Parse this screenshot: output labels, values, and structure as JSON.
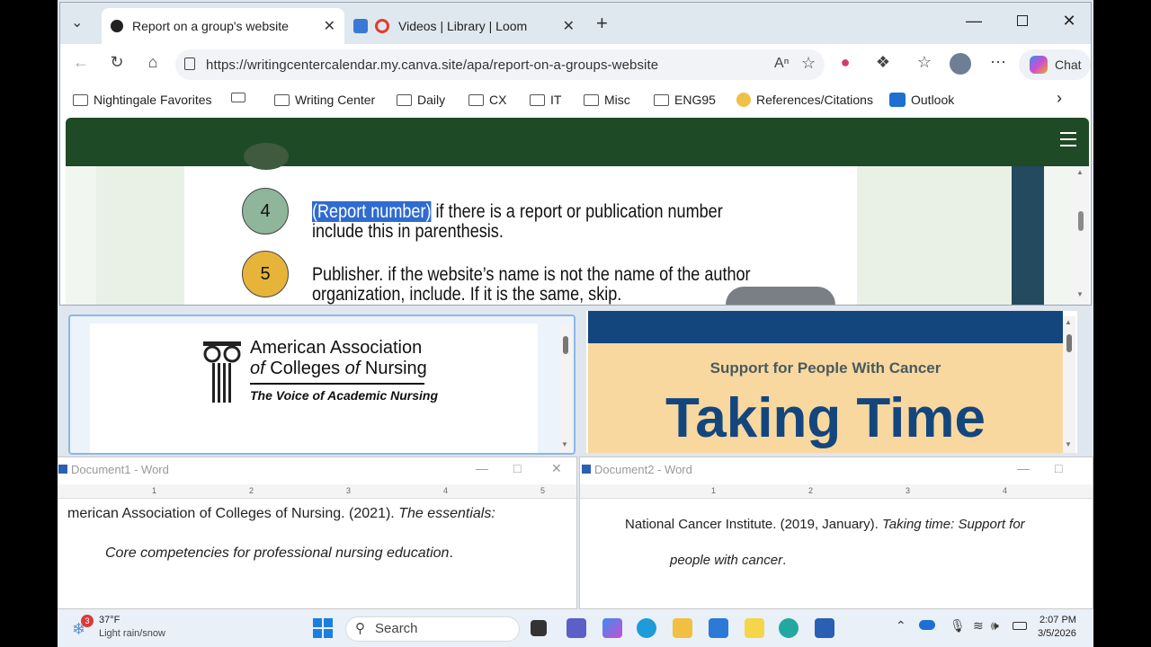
{
  "browser": {
    "tabs": [
      {
        "label": "Report on a group's website",
        "icon": "canva-icon"
      },
      {
        "label": "Videos | Library | Loom",
        "icon": "loom-icon"
      }
    ],
    "url": "https://writingcentercalendar.my.canva.site/apa/report-on-a-groups-website",
    "chat_label": "Chat",
    "bookmarks": [
      "Nightingale Favorites",
      "Writing Center",
      "Daily",
      "CX",
      "IT",
      "Misc",
      "ENG95",
      "References/Citations",
      "Outlook"
    ]
  },
  "slide": {
    "steps": [
      {
        "number": "4",
        "highlight": "(Report number)",
        "line1_rest": " if there is a report or publication number",
        "line2": "include this in parenthesis.",
        "color": "#8fb59a"
      },
      {
        "number": "5",
        "line1": "Publisher.  if the website’s name is not the name of the author",
        "line2": "organization, include. If it is the same, skip.",
        "color": "#e7b43a"
      }
    ]
  },
  "pane1": {
    "logo_line1": "American Association",
    "logo_of1": "of",
    "logo_colleges": "Colleges",
    "logo_of2": "of",
    "logo_nursing": "Nursing",
    "logo_tagline": "The Voice of Academic Nursing"
  },
  "pane2": {
    "subtitle": "Support for People With Cancer",
    "title": "Taking Time"
  },
  "word1": {
    "title": "Document1 - Word",
    "line1_plain": "merican Association of Colleges of Nursing. (2021). ",
    "line1_italic": "The essentials:",
    "line2_italic": "Core competencies for professional nursing education",
    "line2_end": "."
  },
  "word2": {
    "title": "Document2 - Word",
    "line1_plain": "National Cancer Institute. (2019, January). ",
    "line1_italic": "Taking time: Support for",
    "line2_italic": "people with cancer",
    "line2_end": "."
  },
  "ruler_numbers": [
    "1",
    "1",
    "2",
    "3",
    "4",
    "5"
  ],
  "taskbar": {
    "weather_temp": "37°F",
    "weather_desc": "Light rain/snow",
    "weather_badge": "3",
    "search": "Search",
    "time": "2:07 PM",
    "date": "3/5/2026"
  }
}
